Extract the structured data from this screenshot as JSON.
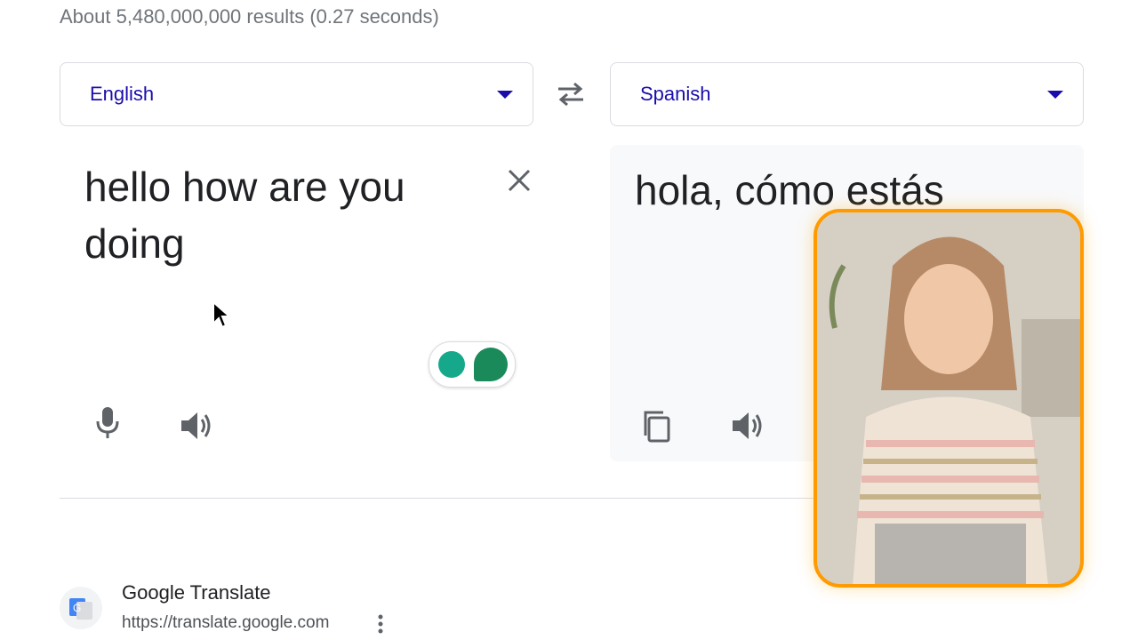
{
  "results_count": "About 5,480,000,000 results (0.27 seconds)",
  "translator": {
    "source_lang": "English",
    "target_lang": "Spanish",
    "source_text": "hello how are you doing",
    "translated_text": "hola, cómo estás"
  },
  "result": {
    "title": "Google Translate",
    "url": "https://translate.google.com"
  },
  "colors": {
    "link_blue": "#1a0dab",
    "grey_text": "#70757a",
    "video_border": "#ff9a00"
  },
  "icons": [
    "swap-icon",
    "clear-icon",
    "microphone-icon",
    "speaker-icon",
    "copy-icon",
    "kebab-menu-icon",
    "cursor-icon",
    "translate-favicon-icon"
  ]
}
